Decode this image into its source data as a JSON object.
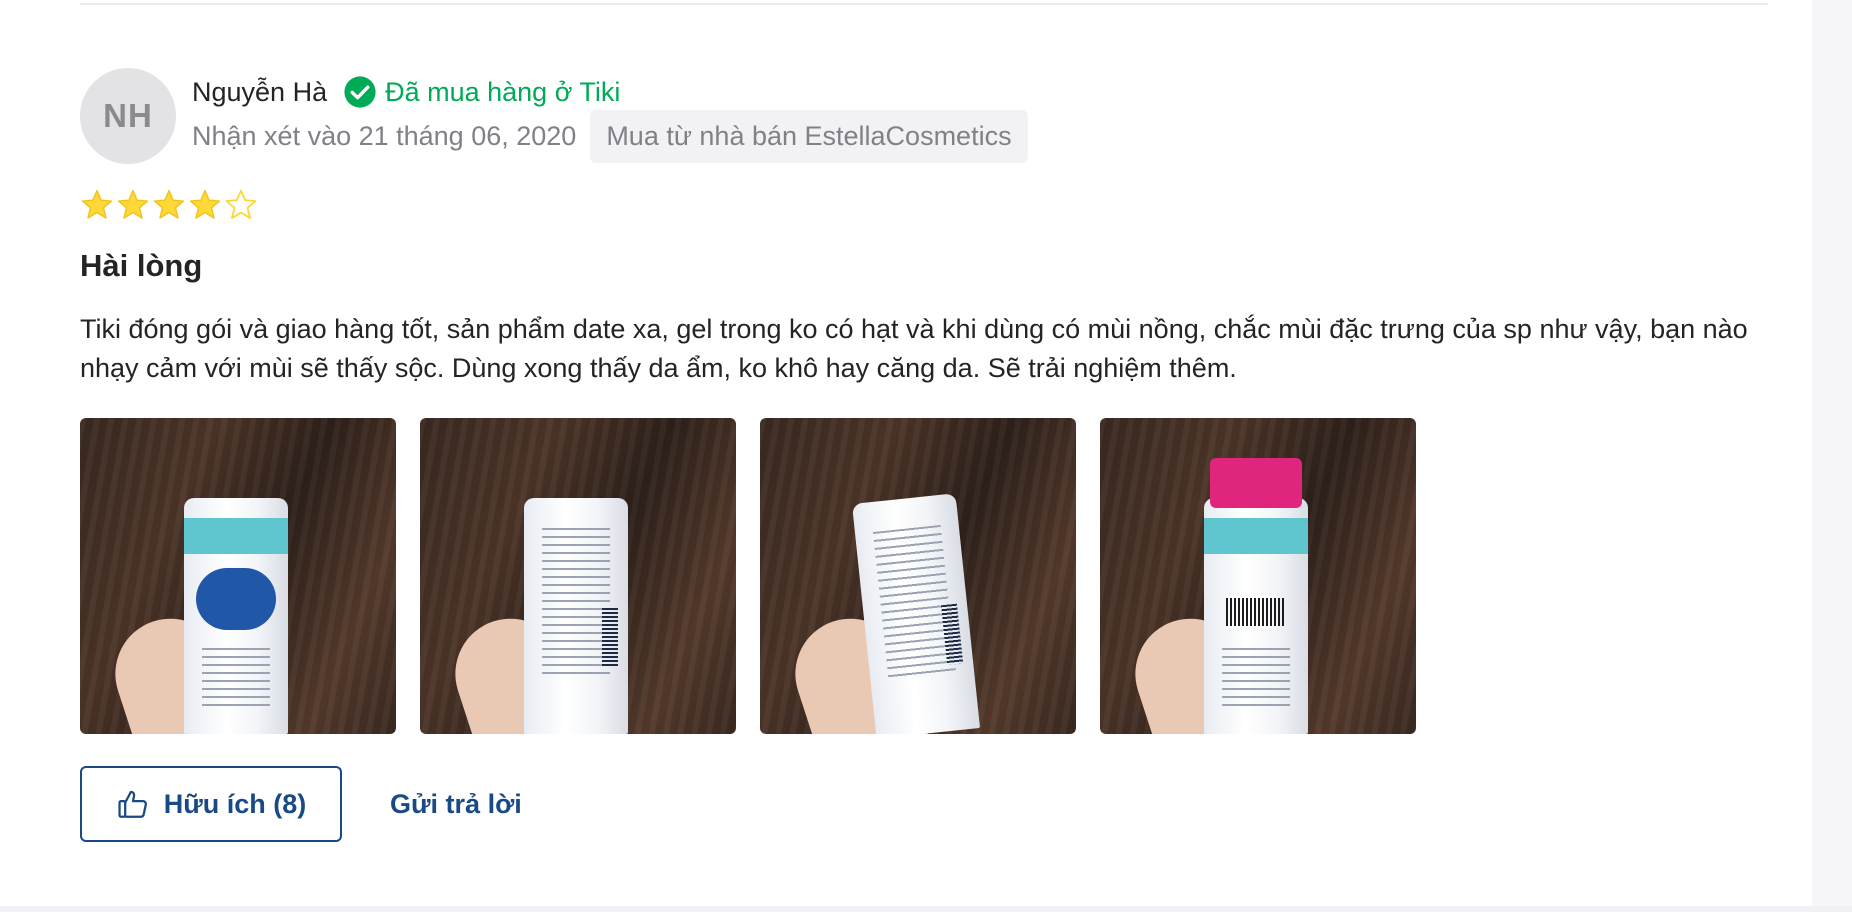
{
  "reviewer": {
    "initials": "NH",
    "name": "Nguyễn Hà",
    "verified_text": "Đã mua hàng ở Tiki",
    "review_date": "Nhận xét vào 21 tháng 06, 2020",
    "seller_badge": "Mua từ nhà bán EstellaCosmetics"
  },
  "rating": {
    "value": 4,
    "max": 5,
    "star_color": "#fdd836"
  },
  "review": {
    "title": "Hài lòng",
    "body": "Tiki đóng gói và giao hàng tốt, sản phẩm date xa, gel trong ko có hạt và khi dùng có mùi nồng, chắc mùi đặc trưng của sp như vậy, bạn nào nhạy cảm với mùi sẽ thấy sộc. Dùng xong thấy da ẩm, ko khô hay căng da. Sẽ trải nghiệm thêm."
  },
  "photos": [
    {
      "kind": "product-front"
    },
    {
      "kind": "product-back"
    },
    {
      "kind": "product-back-angle"
    },
    {
      "kind": "product-packaged"
    }
  ],
  "actions": {
    "helpful_label": "Hữu ích (8)",
    "reply_label": "Gửi trả lời"
  },
  "colors": {
    "verified_green": "#00ab56",
    "action_blue": "#1a4a86",
    "muted_text": "#808089"
  },
  "icons": {
    "verified": "check-circle-icon",
    "star": "star-icon",
    "helpful": "thumbs-up-icon"
  }
}
